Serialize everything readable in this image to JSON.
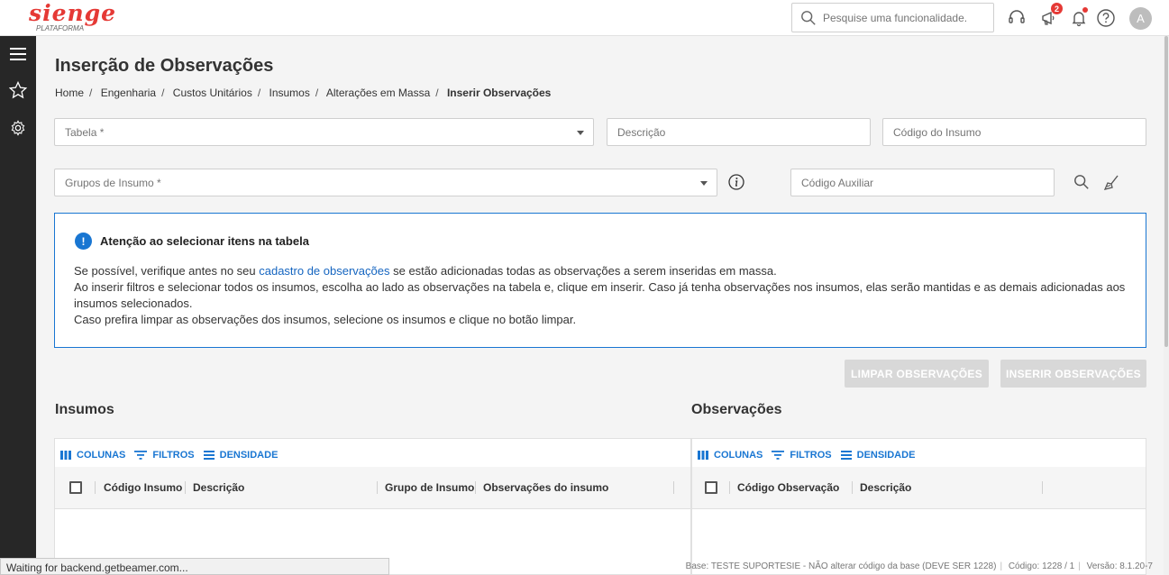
{
  "header": {
    "logo_text": "SIENGE",
    "logo_subtext": "PLATAFORMA",
    "search_placeholder": "Pesquise uma funcionalidade.",
    "notifications_count": "2",
    "avatar_initial": "A"
  },
  "page": {
    "title": "Inserção de Observações",
    "breadcrumb": [
      "Home",
      "Engenharia",
      "Custos Unitários",
      "Insumos",
      "Alterações em Massa",
      "Inserir Observações"
    ]
  },
  "filters": {
    "tabela_placeholder": "Tabela *",
    "descricao_placeholder": "Descrição",
    "codigo_insumo_placeholder": "Código do Insumo",
    "grupos_placeholder": "Grupos de Insumo *",
    "codigo_auxiliar_placeholder": "Código Auxiliar"
  },
  "alert": {
    "title": "Atenção ao selecionar itens na tabela",
    "line1_before": "Se possível, verifique antes no seu ",
    "line1_link": "cadastro de observações",
    "line1_after": " se estão adicionadas todas as observações a serem inseridas em massa.",
    "line2": "Ao inserir filtros e selecionar todos os insumos, escolha ao lado as observações na tabela e, clique em inserir. Caso já tenha observações nos insumos, elas serão mantidas e as demais adicionadas aos insumos selecionados.",
    "line3": "Caso prefira limpar as observações dos insumos, selecione os insumos e clique no botão limpar."
  },
  "actions": {
    "clear_label": "LIMPAR OBSERVAÇÕES",
    "insert_label": "INSERIR OBSERVAÇÕES"
  },
  "insumos": {
    "title": "Insumos",
    "toolbar": [
      "COLUNAS",
      "FILTROS",
      "DENSIDADE"
    ],
    "columns": [
      "Código Insumo",
      "Descrição",
      "Grupo de Insumo",
      "Observações do insumo"
    ]
  },
  "observacoes": {
    "title": "Observações",
    "toolbar": [
      "COLUNAS",
      "FILTROS",
      "DENSIDADE"
    ],
    "columns": [
      "Código Observação",
      "Descrição"
    ]
  },
  "statusbar": {
    "text": "Waiting for backend.getbeamer.com..."
  },
  "footer": {
    "base": "Base: TESTE SUPORTESIE - NÃO alterar código da base (DEVE SER 1228)",
    "codigo": "Código: 1228 / 1",
    "versao": "Versão: 8.1.20-7"
  },
  "colors": {
    "accent": "#1976d2",
    "brand": "#e53935",
    "sidebar": "#272727"
  }
}
